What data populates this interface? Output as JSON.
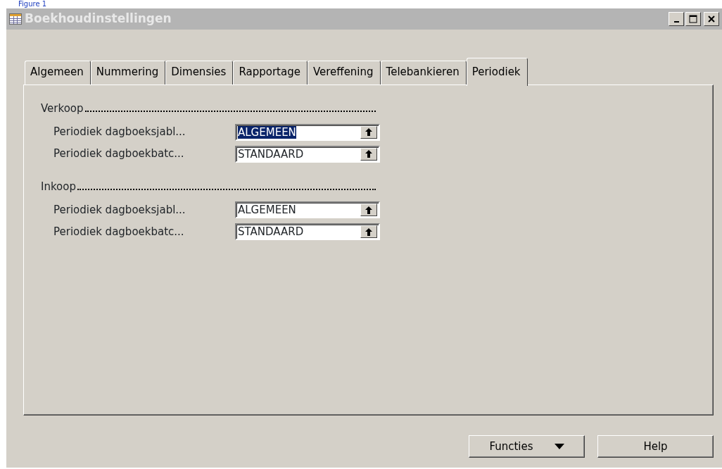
{
  "caption": "Figure 1",
  "window": {
    "title": "Boekhoudinstellingen"
  },
  "tabs": [
    {
      "label": "Algemeen",
      "selected": false
    },
    {
      "label": "Nummering",
      "selected": false
    },
    {
      "label": "Dimensies",
      "selected": false
    },
    {
      "label": "Rapportage",
      "selected": false
    },
    {
      "label": "Vereffening",
      "selected": false
    },
    {
      "label": "Telebankieren",
      "selected": false
    },
    {
      "label": "Periodiek",
      "selected": true
    }
  ],
  "sections": [
    {
      "title": "Verkoop",
      "fields": [
        {
          "label": "Periodiek dagboeksjabl...",
          "value": "ALGEMEEN",
          "selected": true
        },
        {
          "label": "Periodiek dagboekbatc...",
          "value": "STANDAARD",
          "selected": false
        }
      ]
    },
    {
      "title": "Inkoop",
      "fields": [
        {
          "label": "Periodiek dagboeksjabl...",
          "value": "ALGEMEEN",
          "selected": false
        },
        {
          "label": "Periodiek dagboekbatc...",
          "value": "STANDAARD",
          "selected": false
        }
      ]
    }
  ],
  "buttons": [
    {
      "label": "Functies",
      "kind": "dropdown"
    },
    {
      "label": "Help",
      "kind": "plain"
    }
  ]
}
